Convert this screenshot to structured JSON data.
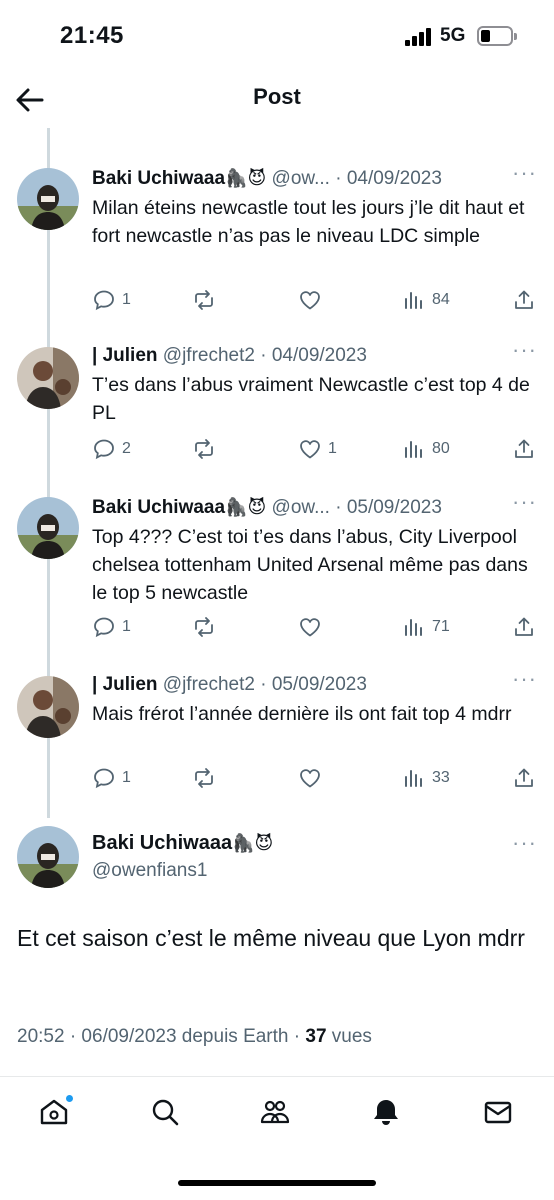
{
  "status_bar": {
    "time": "21:45",
    "network": "5G"
  },
  "header": {
    "title": "Post"
  },
  "replies": [
    {
      "name": "Baki Uchiwaaa",
      "emoji": "🦍😈",
      "handle": "@ow...",
      "date": "04/09/2023",
      "text": "Milan éteins newcastle tout les jours j’le dit haut et fort newcastle n’as pas le niveau LDC simple",
      "replies": "1",
      "reposts": "",
      "likes": "",
      "views": "84"
    },
    {
      "name": "| Julien",
      "emoji": "",
      "handle": "@jfrechet2",
      "date": "04/09/2023",
      "text": "T’es dans l’abus vraiment Newcastle c’est top 4 de PL",
      "replies": "2",
      "reposts": "",
      "likes": "1",
      "views": "80"
    },
    {
      "name": "Baki Uchiwaaa",
      "emoji": "🦍😈",
      "handle": "@ow...",
      "date": "05/09/2023",
      "text": "Top 4??? C’est toi t’es dans l’abus, City Liverpool chelsea tottenham United Arsenal même pas dans le top 5 newcastle",
      "replies": "1",
      "reposts": "",
      "likes": "",
      "views": "71"
    },
    {
      "name": "| Julien",
      "emoji": "",
      "handle": "@jfrechet2",
      "date": "05/09/2023",
      "text": "Mais frérot l’année dernière ils ont fait top 4 mdrr",
      "replies": "1",
      "reposts": "",
      "likes": "",
      "views": "33"
    }
  ],
  "main_post": {
    "name": "Baki Uchiwaaa",
    "emoji": "🦍😈",
    "handle": "@owenfians1",
    "text": "Et cet saison c’est le même niveau que Lyon mdrr",
    "meta": "20:52 · 06/09/2023 depuis Earth · ",
    "views_count": "37",
    "views_label": " vues"
  },
  "colors": {
    "text": "#0f1419",
    "secondary": "#536471",
    "accent": "#1d9bf0",
    "thread_line": "#cfd9de"
  },
  "nav_icons": [
    "home-icon",
    "search-icon",
    "communities-icon",
    "notifications-icon",
    "messages-icon"
  ]
}
